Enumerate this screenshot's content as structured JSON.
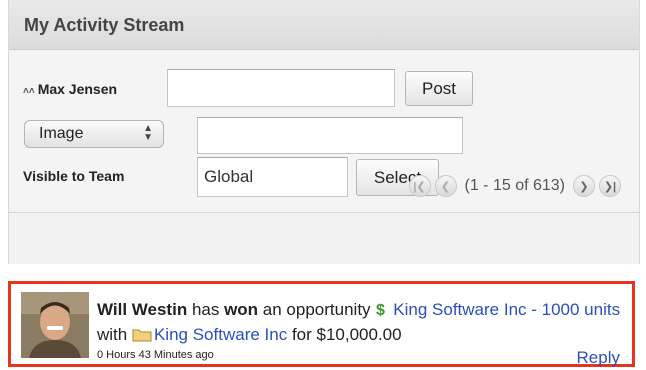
{
  "panel": {
    "title": "My Activity Stream"
  },
  "composer": {
    "user_name": "Max Jensen",
    "post_input_value": "",
    "post_button": "Post",
    "type_select": "Image",
    "type_input_value": "",
    "visible_label": "Visible to Team",
    "team_input_value": "Global",
    "select_button": "Select"
  },
  "pager": {
    "range": "(1 - 15 of 613)"
  },
  "activity": {
    "user": "Will Westin",
    "text_1": " has ",
    "verb": "won",
    "text_2": " an opportunity ",
    "opportunity_link": "King Software Inc - 1000 units",
    "text_3": " with ",
    "account_link": "King Software Inc",
    "text_4": " for $10,000.00",
    "timestamp": "0 Hours 43 Minutes ago",
    "reply": "Reply"
  },
  "colors": {
    "link": "#2a4fbf",
    "highlight_border": "#e8341e",
    "opportunity_icon": "#3a9a2a",
    "account_icon": "#d9b14a"
  }
}
